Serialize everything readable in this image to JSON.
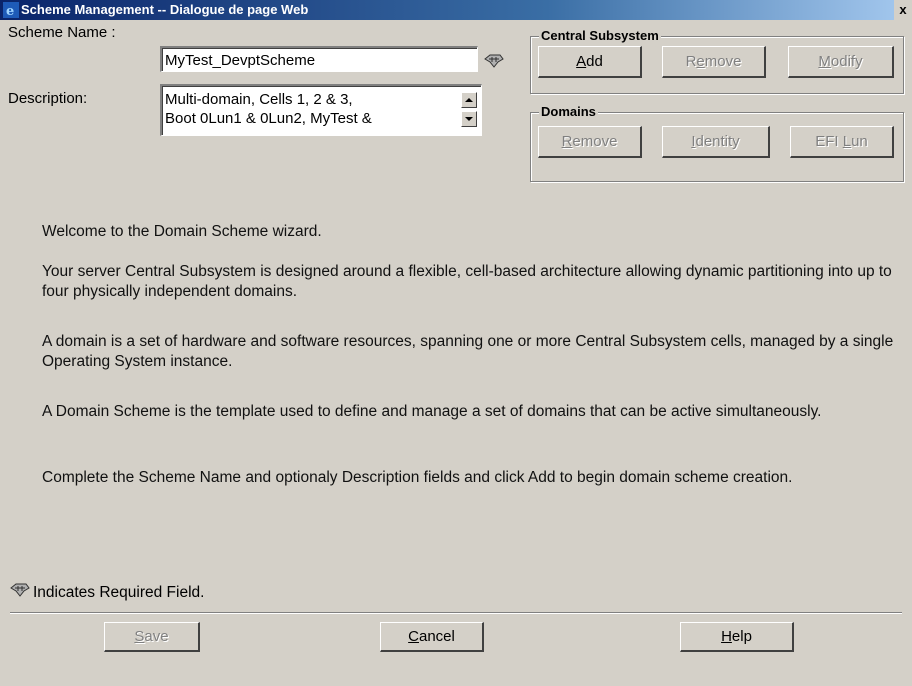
{
  "window": {
    "title": "Scheme Management -- Dialogue de page Web",
    "close_glyph": "x",
    "app_icon": "ie-icon"
  },
  "form": {
    "scheme_name_label": "Scheme Name :",
    "scheme_name_value": "MyTest_DevptScheme",
    "description_label": "Description:",
    "description_line1": "Multi-domain, Cells 1, 2 & 3,",
    "description_line2": "Boot 0Lun1 & 0Lun2, MyTest &",
    "required_icon": "required-field-icon"
  },
  "central_subsystem": {
    "label": "Central Subsystem",
    "add": {
      "pre": "",
      "u": "A",
      "post": "dd",
      "enabled": true
    },
    "remove": {
      "pre": "R",
      "u": "e",
      "post": "move",
      "enabled": false
    },
    "modify": {
      "pre": "",
      "u": "M",
      "post": "odify",
      "enabled": false
    }
  },
  "domains": {
    "label": "Domains",
    "remove": {
      "pre": "",
      "u": "R",
      "post": "emove",
      "enabled": false
    },
    "identity": {
      "pre": "",
      "u": "I",
      "post": "dentity",
      "enabled": false
    },
    "efi_lun": {
      "pre": "EFI ",
      "u": "L",
      "post": "un",
      "enabled": false
    }
  },
  "welcome": {
    "p1": "Welcome to the Domain Scheme wizard.",
    "p2": "Your server Central Subsystem is designed around a flexible, cell-based architecture allowing dynamic partitioning into up to four physically independent domains.",
    "p3": "A domain is a set of hardware and software resources, spanning one or more Central Subsystem cells, managed by a single Operating System instance.",
    "p4": "A Domain Scheme is the template used to define and manage a set of domains that can be active simultaneously.",
    "p5": "Complete the Scheme Name and optionaly Description fields and click Add to begin domain scheme creation."
  },
  "footer": {
    "required_note": "Indicates Required Field.",
    "save": {
      "pre": "",
      "u": "S",
      "post": "ave",
      "enabled": false
    },
    "cancel": {
      "pre": "",
      "u": "C",
      "post": "ancel",
      "enabled": true
    },
    "help": {
      "pre": "",
      "u": "H",
      "post": "elp",
      "enabled": true
    }
  }
}
